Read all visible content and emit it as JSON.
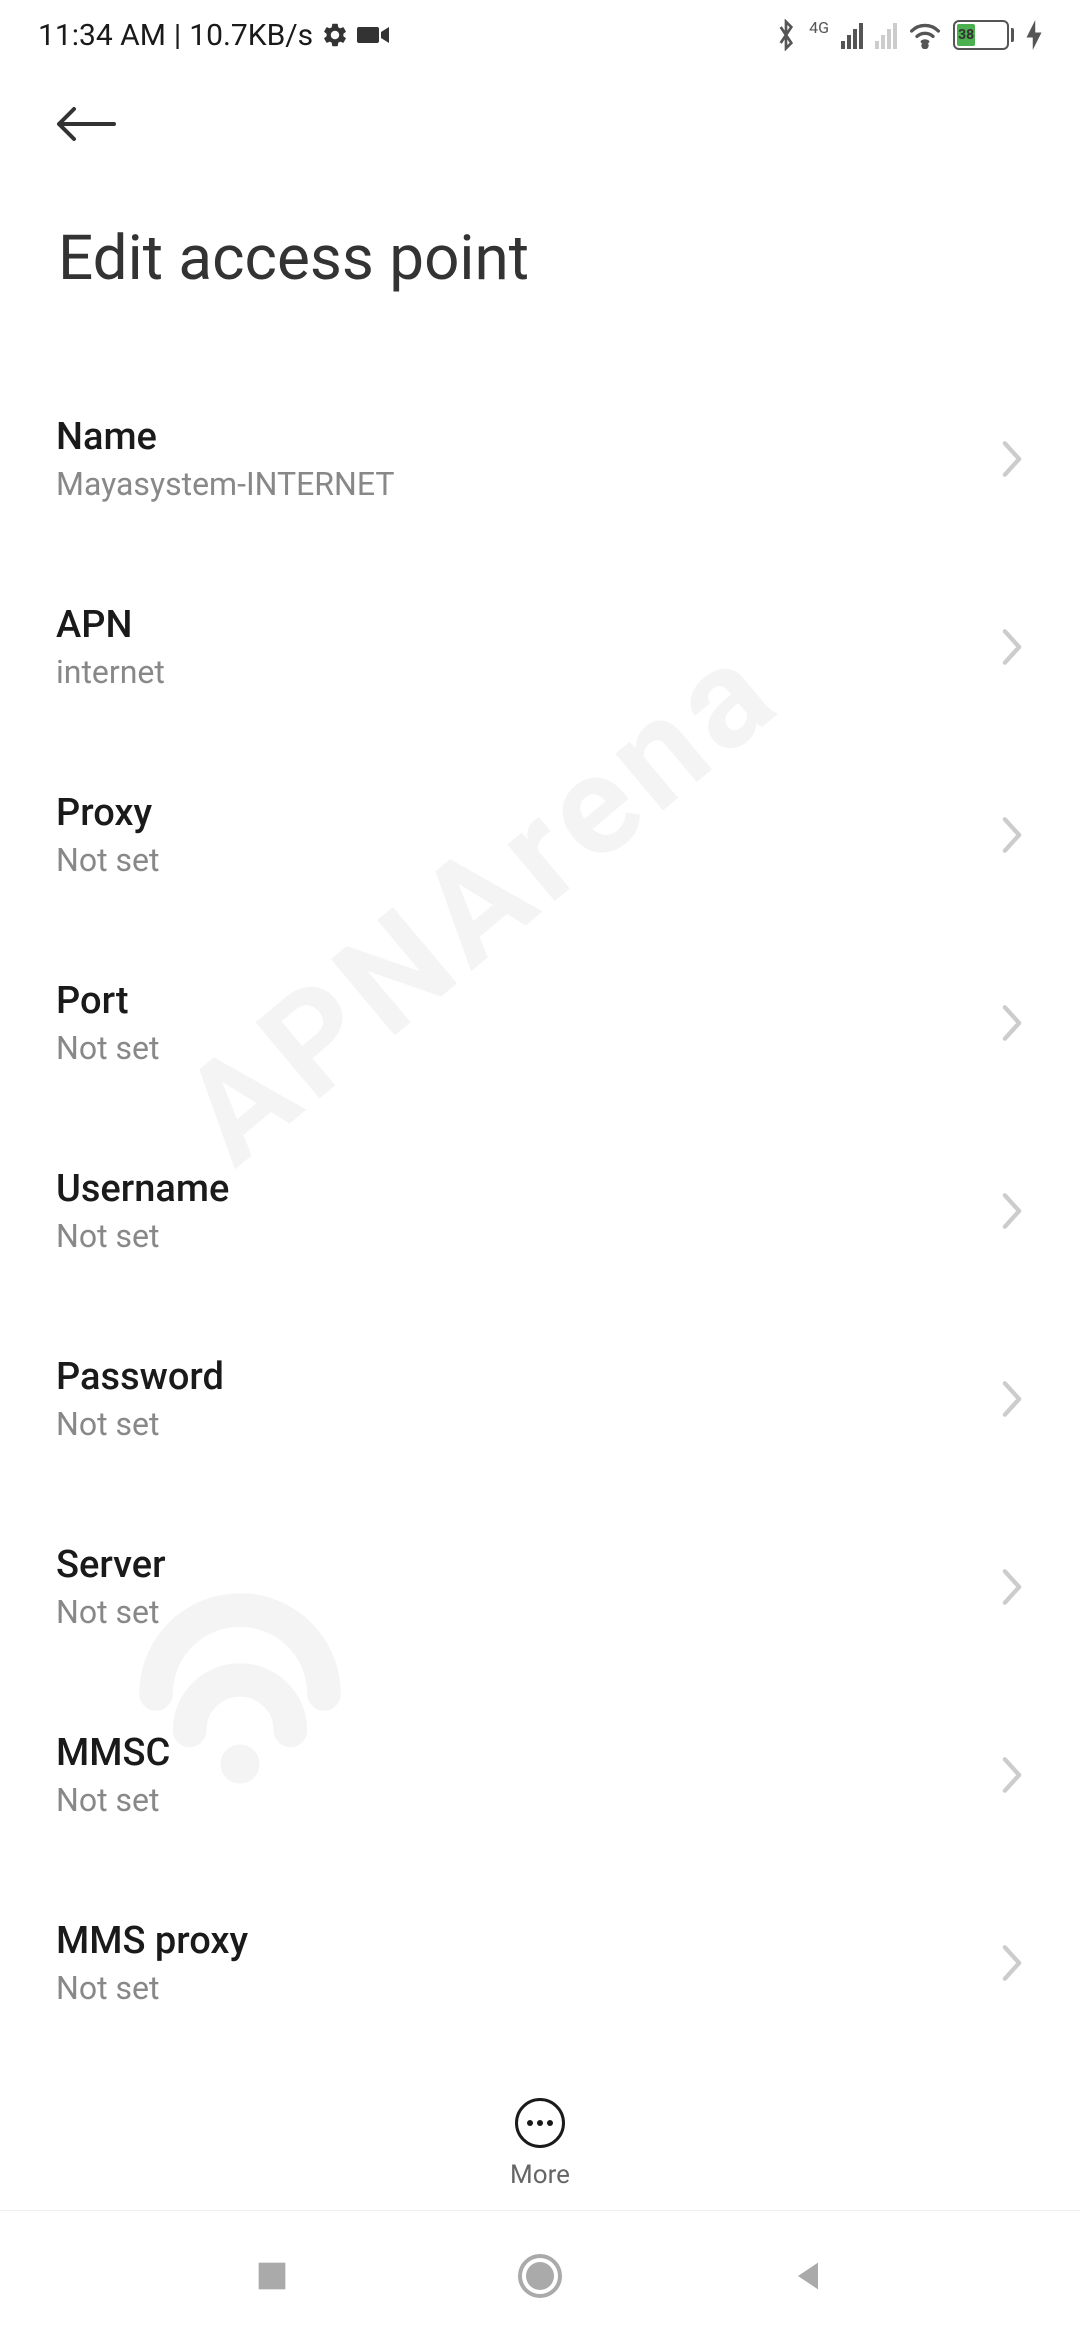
{
  "status_bar": {
    "time": "11:34 AM",
    "data_rate": "10.7KB/s",
    "battery_percent": "38",
    "network_type": "4G"
  },
  "header": {
    "title": "Edit access point"
  },
  "settings": [
    {
      "label": "Name",
      "value": "Mayasystem-INTERNET"
    },
    {
      "label": "APN",
      "value": "internet"
    },
    {
      "label": "Proxy",
      "value": "Not set"
    },
    {
      "label": "Port",
      "value": "Not set"
    },
    {
      "label": "Username",
      "value": "Not set"
    },
    {
      "label": "Password",
      "value": "Not set"
    },
    {
      "label": "Server",
      "value": "Not set"
    },
    {
      "label": "MMSC",
      "value": "Not set"
    },
    {
      "label": "MMS proxy",
      "value": "Not set"
    }
  ],
  "bottom_bar": {
    "more_label": "More"
  },
  "watermark": "APNArena"
}
